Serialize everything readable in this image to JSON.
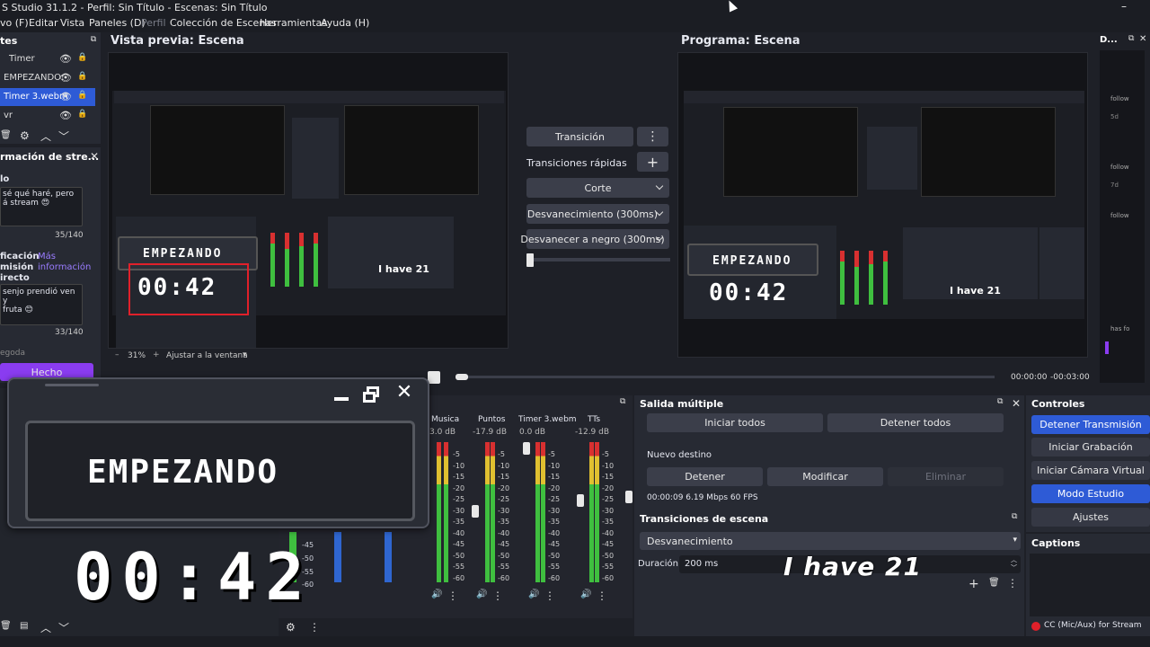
{
  "titlebar": {
    "text": "S Studio 31.1.2 - Perfil: Sin Título - Escenas: Sin Título"
  },
  "menu": [
    "vo (F)",
    "Editar",
    "Vista",
    "Paneles (D)",
    "Perfil",
    "Colección de Escenas",
    "Herramientas",
    "Ayuda (H)"
  ],
  "sources": {
    "title": "tes",
    "items": [
      "Timer",
      "EMPEZANDO:",
      "Timer 3.webm",
      "vr"
    ]
  },
  "chat": {
    "title": "rmación de stre...",
    "label1": "lo",
    "text1_line1": "sé qué haré, pero",
    "text1_line2": "á stream 😍",
    "count1": "35/140",
    "notif_label_l1": "ficación",
    "notif_label_l2": "misión",
    "notif_label_l3": "irecto",
    "more_info_l1": "Más",
    "more_info_l2": "información",
    "text2_line1": "senjo prendió ven y",
    "text2_line2": "fruta 😊",
    "count2": "33/140",
    "footer": "egoda",
    "done_button": "Hecho"
  },
  "preview": {
    "title": "Vista previa: Escena",
    "zoom": "31%",
    "fit_label": "Ajustar a la ventana",
    "overlay_title": "EMPEZANDO",
    "overlay_timer": "00:42",
    "mini_text": "I have 21"
  },
  "program": {
    "title": "Programa: Escena",
    "overlay_title": "EMPEZANDO",
    "overlay_timer": "00:42",
    "mini_text": "I have 21"
  },
  "transitions_center": {
    "transition_button": "Transición",
    "quick_label": "Transiciones rápidas",
    "options": [
      "Corte",
      "Desvanecimiento (300ms)",
      "Desvanecer a negro (300ms)"
    ]
  },
  "media": {
    "time_current": "00:00:00",
    "time_remaining": "-00:03:00"
  },
  "popup": {
    "title": "EMPEZANDO",
    "timer": "00:42",
    "side_text": "I have 21"
  },
  "mixer": {
    "channels": [
      {
        "name": "Musica",
        "db": "3.0 dB"
      },
      {
        "name": "Puntos",
        "db": "-17.9 dB"
      },
      {
        "name": "Timer 3.webm",
        "db": "0.0 dB"
      },
      {
        "name": "TTs",
        "db": "-12.9 dB"
      }
    ],
    "scale": [
      "-5",
      "-10",
      "-15",
      "-20",
      "-25",
      "-30",
      "-35",
      "-40",
      "-45",
      "-50",
      "-55",
      "-60"
    ],
    "left_scale": [
      "-45",
      "-50",
      "-55",
      "-60"
    ]
  },
  "multi_output": {
    "title": "Salida múltiple",
    "start_all": "Iniciar todos",
    "stop_all": "Detener todos",
    "new_dest": "Nuevo destino",
    "stop": "Detener",
    "modify": "Modificar",
    "delete": "Eliminar",
    "stats": "00:00:09  6.19 Mbps  60 FPS"
  },
  "scene_transitions": {
    "title": "Transiciones de escena",
    "selected": "Desvanecimiento",
    "duration_label": "Duración",
    "duration_value": "200 ms"
  },
  "controls": {
    "title": "Controles",
    "buttons": [
      "Detener Transmisión",
      "Iniciar Grabación",
      "Iniciar Cámara Virtual",
      "Modo Estudio",
      "Ajustes"
    ]
  },
  "captions": {
    "title": "Captions",
    "status": "CC (Mic/Aux) for Stream"
  },
  "activity": {
    "title": "D...",
    "items": [
      "follow",
      "5d",
      "follow",
      "7d",
      "follow",
      "has fo"
    ]
  },
  "colors": {
    "accent_blue": "#2e5bd6",
    "purple": "#8a3cf0",
    "red_selection": "#e0202a",
    "meter_green": "#3fbf3f",
    "meter_red": "#d83030"
  }
}
